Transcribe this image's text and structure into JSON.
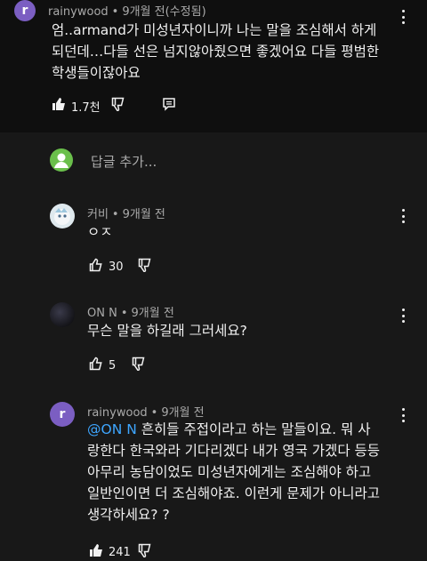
{
  "comment_top": {
    "author": "rainywood",
    "time": "9개월 전(수정됨)",
    "avatar_letter": "r",
    "avatar_color": "#7b5ec2",
    "text": "엄..armand가 미성년자이니까 나는 말을 조심해서 하게 되던데…다들 선은 넘지않아줬으면 좋겠어요 다들 평범한 학생들이잖아요",
    "likes": "1.7천"
  },
  "reply_box": {
    "placeholder": "답글 추가..."
  },
  "replies": [
    {
      "author": "커비",
      "time": "9개월 전",
      "text": "ㅇㅈ",
      "likes": "30"
    },
    {
      "author": "ON N",
      "time": "9개월 전",
      "text": "무슨 말을 하길래 그러세요?",
      "likes": "5"
    },
    {
      "author": "rainywood",
      "time": "9개월 전",
      "avatar_letter": "r",
      "mention": "@ON N",
      "text": " 흔히들 주접이라고 하는 말들이요. 뭐 사랑한다 한국와라 기다리겠다 내가 영국 가겠다 등등 아무리 농담이었도 미성년자에게는 조심해야 하고 일반인이면 더 조심해야죠. 이런게 문제가 아니라고 생각하세요? ?",
      "likes": "241"
    }
  ],
  "icons": [
    "like-icon",
    "dislike-icon",
    "reply-icon",
    "more-icon"
  ],
  "colors": {
    "accent": "#3ea6ff",
    "background": "#181818",
    "text": "#f1f1f1",
    "meta": "#aaaaaa"
  }
}
